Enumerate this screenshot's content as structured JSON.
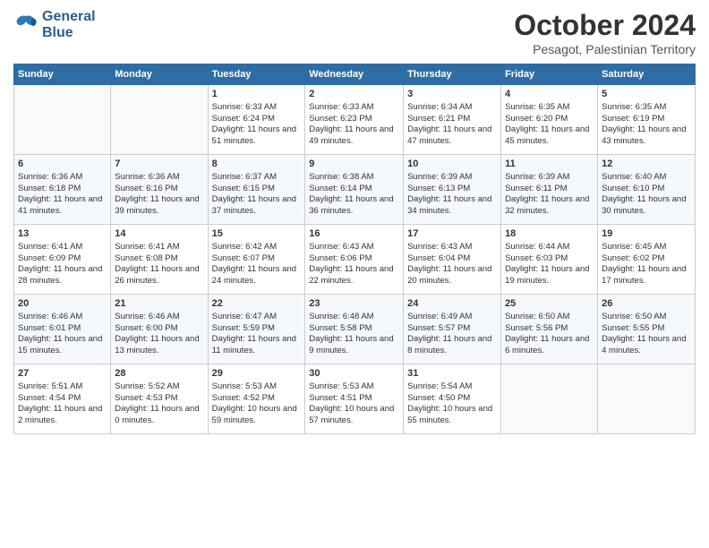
{
  "logo": {
    "line1": "General",
    "line2": "Blue"
  },
  "title": "October 2024",
  "location": "Pesagot, Palestinian Territory",
  "days_header": [
    "Sunday",
    "Monday",
    "Tuesday",
    "Wednesday",
    "Thursday",
    "Friday",
    "Saturday"
  ],
  "weeks": [
    [
      {
        "day": "",
        "sunrise": "",
        "sunset": "",
        "daylight": ""
      },
      {
        "day": "",
        "sunrise": "",
        "sunset": "",
        "daylight": ""
      },
      {
        "day": "1",
        "sunrise": "Sunrise: 6:33 AM",
        "sunset": "Sunset: 6:24 PM",
        "daylight": "Daylight: 11 hours and 51 minutes."
      },
      {
        "day": "2",
        "sunrise": "Sunrise: 6:33 AM",
        "sunset": "Sunset: 6:23 PM",
        "daylight": "Daylight: 11 hours and 49 minutes."
      },
      {
        "day": "3",
        "sunrise": "Sunrise: 6:34 AM",
        "sunset": "Sunset: 6:21 PM",
        "daylight": "Daylight: 11 hours and 47 minutes."
      },
      {
        "day": "4",
        "sunrise": "Sunrise: 6:35 AM",
        "sunset": "Sunset: 6:20 PM",
        "daylight": "Daylight: 11 hours and 45 minutes."
      },
      {
        "day": "5",
        "sunrise": "Sunrise: 6:35 AM",
        "sunset": "Sunset: 6:19 PM",
        "daylight": "Daylight: 11 hours and 43 minutes."
      }
    ],
    [
      {
        "day": "6",
        "sunrise": "Sunrise: 6:36 AM",
        "sunset": "Sunset: 6:18 PM",
        "daylight": "Daylight: 11 hours and 41 minutes."
      },
      {
        "day": "7",
        "sunrise": "Sunrise: 6:36 AM",
        "sunset": "Sunset: 6:16 PM",
        "daylight": "Daylight: 11 hours and 39 minutes."
      },
      {
        "day": "8",
        "sunrise": "Sunrise: 6:37 AM",
        "sunset": "Sunset: 6:15 PM",
        "daylight": "Daylight: 11 hours and 37 minutes."
      },
      {
        "day": "9",
        "sunrise": "Sunrise: 6:38 AM",
        "sunset": "Sunset: 6:14 PM",
        "daylight": "Daylight: 11 hours and 36 minutes."
      },
      {
        "day": "10",
        "sunrise": "Sunrise: 6:39 AM",
        "sunset": "Sunset: 6:13 PM",
        "daylight": "Daylight: 11 hours and 34 minutes."
      },
      {
        "day": "11",
        "sunrise": "Sunrise: 6:39 AM",
        "sunset": "Sunset: 6:11 PM",
        "daylight": "Daylight: 11 hours and 32 minutes."
      },
      {
        "day": "12",
        "sunrise": "Sunrise: 6:40 AM",
        "sunset": "Sunset: 6:10 PM",
        "daylight": "Daylight: 11 hours and 30 minutes."
      }
    ],
    [
      {
        "day": "13",
        "sunrise": "Sunrise: 6:41 AM",
        "sunset": "Sunset: 6:09 PM",
        "daylight": "Daylight: 11 hours and 28 minutes."
      },
      {
        "day": "14",
        "sunrise": "Sunrise: 6:41 AM",
        "sunset": "Sunset: 6:08 PM",
        "daylight": "Daylight: 11 hours and 26 minutes."
      },
      {
        "day": "15",
        "sunrise": "Sunrise: 6:42 AM",
        "sunset": "Sunset: 6:07 PM",
        "daylight": "Daylight: 11 hours and 24 minutes."
      },
      {
        "day": "16",
        "sunrise": "Sunrise: 6:43 AM",
        "sunset": "Sunset: 6:06 PM",
        "daylight": "Daylight: 11 hours and 22 minutes."
      },
      {
        "day": "17",
        "sunrise": "Sunrise: 6:43 AM",
        "sunset": "Sunset: 6:04 PM",
        "daylight": "Daylight: 11 hours and 20 minutes."
      },
      {
        "day": "18",
        "sunrise": "Sunrise: 6:44 AM",
        "sunset": "Sunset: 6:03 PM",
        "daylight": "Daylight: 11 hours and 19 minutes."
      },
      {
        "day": "19",
        "sunrise": "Sunrise: 6:45 AM",
        "sunset": "Sunset: 6:02 PM",
        "daylight": "Daylight: 11 hours and 17 minutes."
      }
    ],
    [
      {
        "day": "20",
        "sunrise": "Sunrise: 6:46 AM",
        "sunset": "Sunset: 6:01 PM",
        "daylight": "Daylight: 11 hours and 15 minutes."
      },
      {
        "day": "21",
        "sunrise": "Sunrise: 6:46 AM",
        "sunset": "Sunset: 6:00 PM",
        "daylight": "Daylight: 11 hours and 13 minutes."
      },
      {
        "day": "22",
        "sunrise": "Sunrise: 6:47 AM",
        "sunset": "Sunset: 5:59 PM",
        "daylight": "Daylight: 11 hours and 11 minutes."
      },
      {
        "day": "23",
        "sunrise": "Sunrise: 6:48 AM",
        "sunset": "Sunset: 5:58 PM",
        "daylight": "Daylight: 11 hours and 9 minutes."
      },
      {
        "day": "24",
        "sunrise": "Sunrise: 6:49 AM",
        "sunset": "Sunset: 5:57 PM",
        "daylight": "Daylight: 11 hours and 8 minutes."
      },
      {
        "day": "25",
        "sunrise": "Sunrise: 6:50 AM",
        "sunset": "Sunset: 5:56 PM",
        "daylight": "Daylight: 11 hours and 6 minutes."
      },
      {
        "day": "26",
        "sunrise": "Sunrise: 6:50 AM",
        "sunset": "Sunset: 5:55 PM",
        "daylight": "Daylight: 11 hours and 4 minutes."
      }
    ],
    [
      {
        "day": "27",
        "sunrise": "Sunrise: 5:51 AM",
        "sunset": "Sunset: 4:54 PM",
        "daylight": "Daylight: 11 hours and 2 minutes."
      },
      {
        "day": "28",
        "sunrise": "Sunrise: 5:52 AM",
        "sunset": "Sunset: 4:53 PM",
        "daylight": "Daylight: 11 hours and 0 minutes."
      },
      {
        "day": "29",
        "sunrise": "Sunrise: 5:53 AM",
        "sunset": "Sunset: 4:52 PM",
        "daylight": "Daylight: 10 hours and 59 minutes."
      },
      {
        "day": "30",
        "sunrise": "Sunrise: 5:53 AM",
        "sunset": "Sunset: 4:51 PM",
        "daylight": "Daylight: 10 hours and 57 minutes."
      },
      {
        "day": "31",
        "sunrise": "Sunrise: 5:54 AM",
        "sunset": "Sunset: 4:50 PM",
        "daylight": "Daylight: 10 hours and 55 minutes."
      },
      {
        "day": "",
        "sunrise": "",
        "sunset": "",
        "daylight": ""
      },
      {
        "day": "",
        "sunrise": "",
        "sunset": "",
        "daylight": ""
      }
    ]
  ]
}
